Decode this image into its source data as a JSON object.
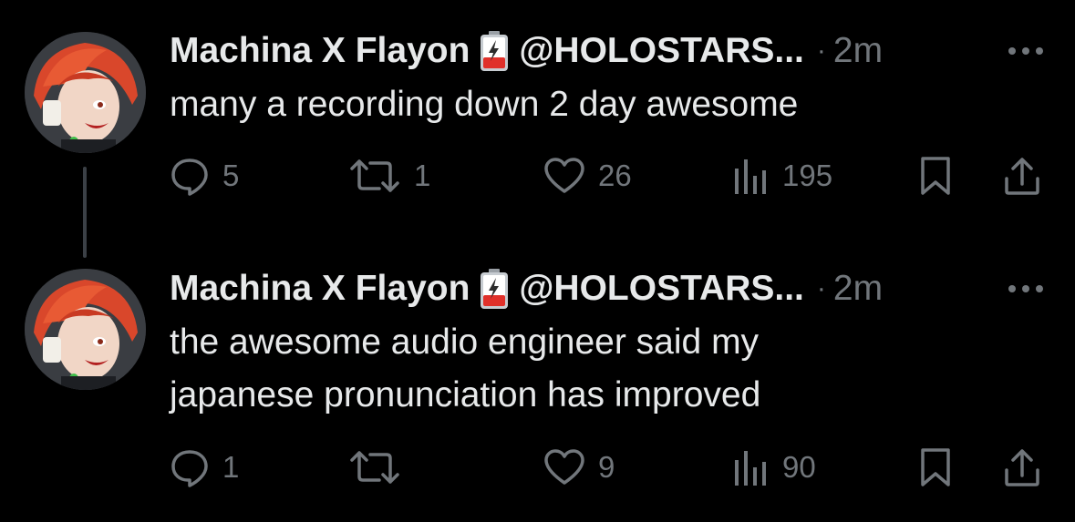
{
  "tweets": [
    {
      "author_name": "Machina X Flayon",
      "author_handle": "@HOLOSTARS...",
      "separator": "·",
      "time": "2m",
      "text": "many a recording down 2 day awesome",
      "replies": "5",
      "retweets": "1",
      "likes": "26",
      "views": "195"
    },
    {
      "author_name": "Machina X Flayon",
      "author_handle": "@HOLOSTARS...",
      "separator": "·",
      "time": "2m",
      "text": "the awesome audio engineer said my japanese pronunciation has improved",
      "replies": "1",
      "retweets": "",
      "likes": "9",
      "views": "90"
    }
  ],
  "icons": {
    "reply": "reply-icon",
    "retweet": "retweet-icon",
    "like": "heart-icon",
    "views": "views-chart-icon",
    "bookmark": "bookmark-icon",
    "share": "share-icon",
    "more": "more-options-icon",
    "badge": "battery-emoji-icon"
  },
  "colors": {
    "background": "#000000",
    "primary_text": "#e7e9ea",
    "secondary_text": "#71767b",
    "thread_line": "#3b4046",
    "avatar_hair": "#d9472b"
  }
}
